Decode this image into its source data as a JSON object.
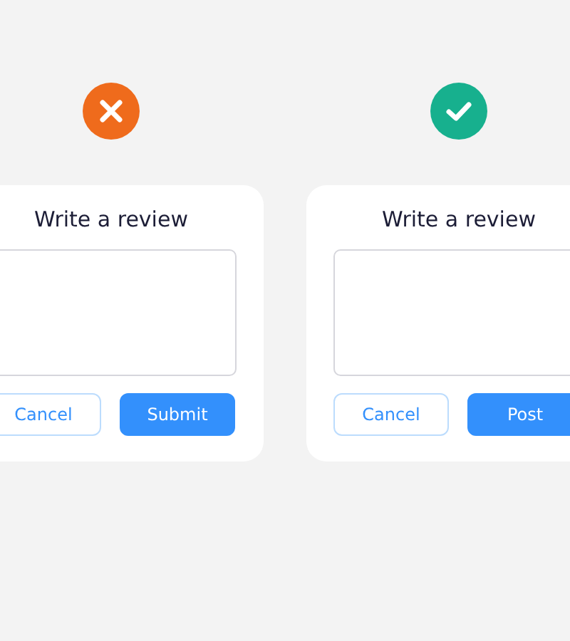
{
  "examples": [
    {
      "kind": "bad",
      "card": {
        "title": "Write a review",
        "buttons": [
          {
            "label": "Cancel",
            "kind": "secondary"
          },
          {
            "label": "Submit",
            "kind": "primary"
          }
        ]
      }
    },
    {
      "kind": "good",
      "card": {
        "title": "Write a review",
        "buttons": [
          {
            "label": "Cancel",
            "kind": "secondary"
          },
          {
            "label": "Post",
            "kind": "primary"
          }
        ]
      }
    }
  ]
}
